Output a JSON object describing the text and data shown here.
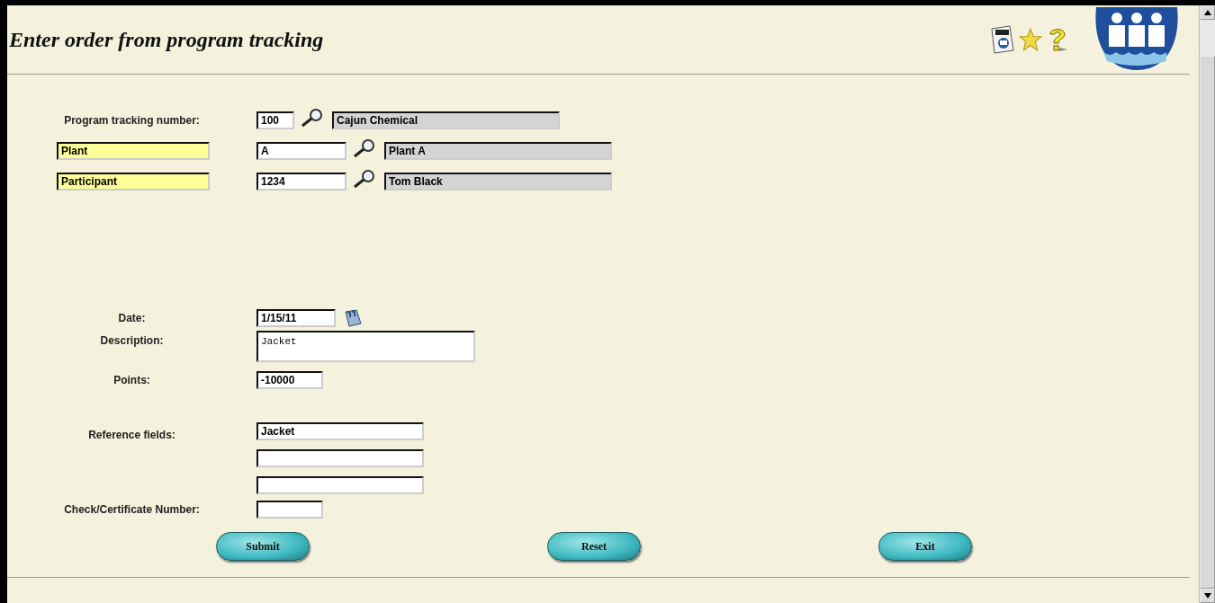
{
  "title": "Enter order from program tracking",
  "lookups": [
    {
      "kind": "label",
      "label": "Program tracking number:",
      "value": "100",
      "name_value": "Cajun Chemical"
    },
    {
      "kind": "field",
      "label": "Plant",
      "value": "A",
      "name_value": "Plant A"
    },
    {
      "kind": "field",
      "label": "Participant",
      "value": "1234",
      "name_value": "Tom Black"
    }
  ],
  "date": {
    "label": "Date:",
    "value": "1/15/11"
  },
  "description": {
    "label": "Description:",
    "value": "Jacket"
  },
  "points": {
    "label": "Points:",
    "value": "-10000"
  },
  "reference": {
    "label": "Reference fields:",
    "values": [
      "Jacket"
    ]
  },
  "check_number": {
    "label": "Check/Certificate Number:"
  },
  "buttons": [
    "Submit",
    "Reset",
    "Exit"
  ]
}
